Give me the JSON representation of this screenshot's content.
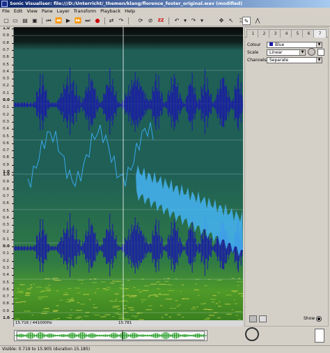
{
  "window": {
    "title": "Sonic Visualiser: file:///D:/Unterricht/_themen/klang/florence_foster_original.wav (modified)"
  },
  "menu": [
    "File",
    "Edit",
    "View",
    "Pane",
    "Layer",
    "Transform",
    "Playback",
    "Help"
  ],
  "toolbar": {
    "buttons": [
      "new",
      "open",
      "save-project",
      "save",
      "rewind-start",
      "rewind",
      "play",
      "fast-forward",
      "fast-forward-end",
      "record",
      "loop",
      "solo",
      "zoom-fit",
      "undo",
      "redo",
      "navigate",
      "select",
      "draw",
      "measure"
    ]
  },
  "ruler": {
    "labels_top": [
      "1.0",
      "0.9",
      "0.8",
      "0.7",
      "0.6",
      "0.5",
      "0.4",
      "0.3",
      "0.2",
      "0.1",
      "0.0",
      "0.1",
      "0.2",
      "0.3",
      "0.4",
      "0.5",
      "0.6",
      "0.7",
      "0.8",
      "0.9",
      "1.0"
    ],
    "labels_bottom": [
      "1.0",
      "0.9",
      "0.8",
      "0.7",
      "0.6",
      "0.5",
      "0.4",
      "0.3",
      "0.2",
      "0.1",
      "0.0",
      "0.1",
      "0.2",
      "0.3",
      "0.4",
      "0.5",
      "0.6",
      "0.7",
      "0.8",
      "0.9",
      "1.0"
    ]
  },
  "timebar": {
    "left": "15.716 / 441000Hz",
    "mid": "15.781"
  },
  "panel": {
    "tabs": [
      "1",
      "2",
      "3",
      "4",
      "5",
      "6",
      "7"
    ],
    "colour_label": "Colour",
    "colour_value": "Blue",
    "scale_label": "Scale",
    "scale_value": "Linear",
    "channels_label": "Channels",
    "channels_value": "Separate",
    "show_label": "Show"
  },
  "status": {
    "text": "Visible: 0.719 to 15.905 (duration 15.185)"
  },
  "colors": {
    "waveform": "#1a1aa8",
    "pitch": "#39a8ee",
    "spectro_top": "#1f5f56",
    "spectro_bottom": "#4f9a28",
    "accent": "#0a246a"
  }
}
